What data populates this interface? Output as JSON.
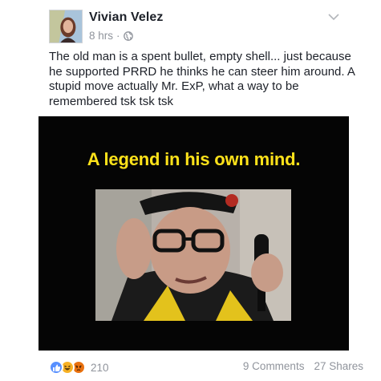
{
  "post": {
    "author": "Vivian Velez",
    "time": "8 hrs",
    "separator": "·",
    "audience_icon": "globe-icon",
    "options_icon": "chevron-down-icon",
    "text": "The old man is a spent bullet, empty shell... just because he supported PRRD he thinks he can steer him around. A stupid move actually Mr. ExP, what a way to be remembered tsk tsk tsk"
  },
  "image": {
    "caption": "A legend in his own mind.",
    "caption_color": "#ffe21a",
    "background_color": "#050505"
  },
  "footer": {
    "reaction_icons": [
      "like-icon",
      "haha-icon",
      "angry-icon"
    ],
    "reaction_count": "210",
    "comments": "9 Comments",
    "shares": "27 Shares"
  },
  "colors": {
    "author": "#1d2129",
    "muted": "#90949c",
    "like": "#5890ff",
    "haha": "#f7b125",
    "angry": "#e9710f"
  }
}
